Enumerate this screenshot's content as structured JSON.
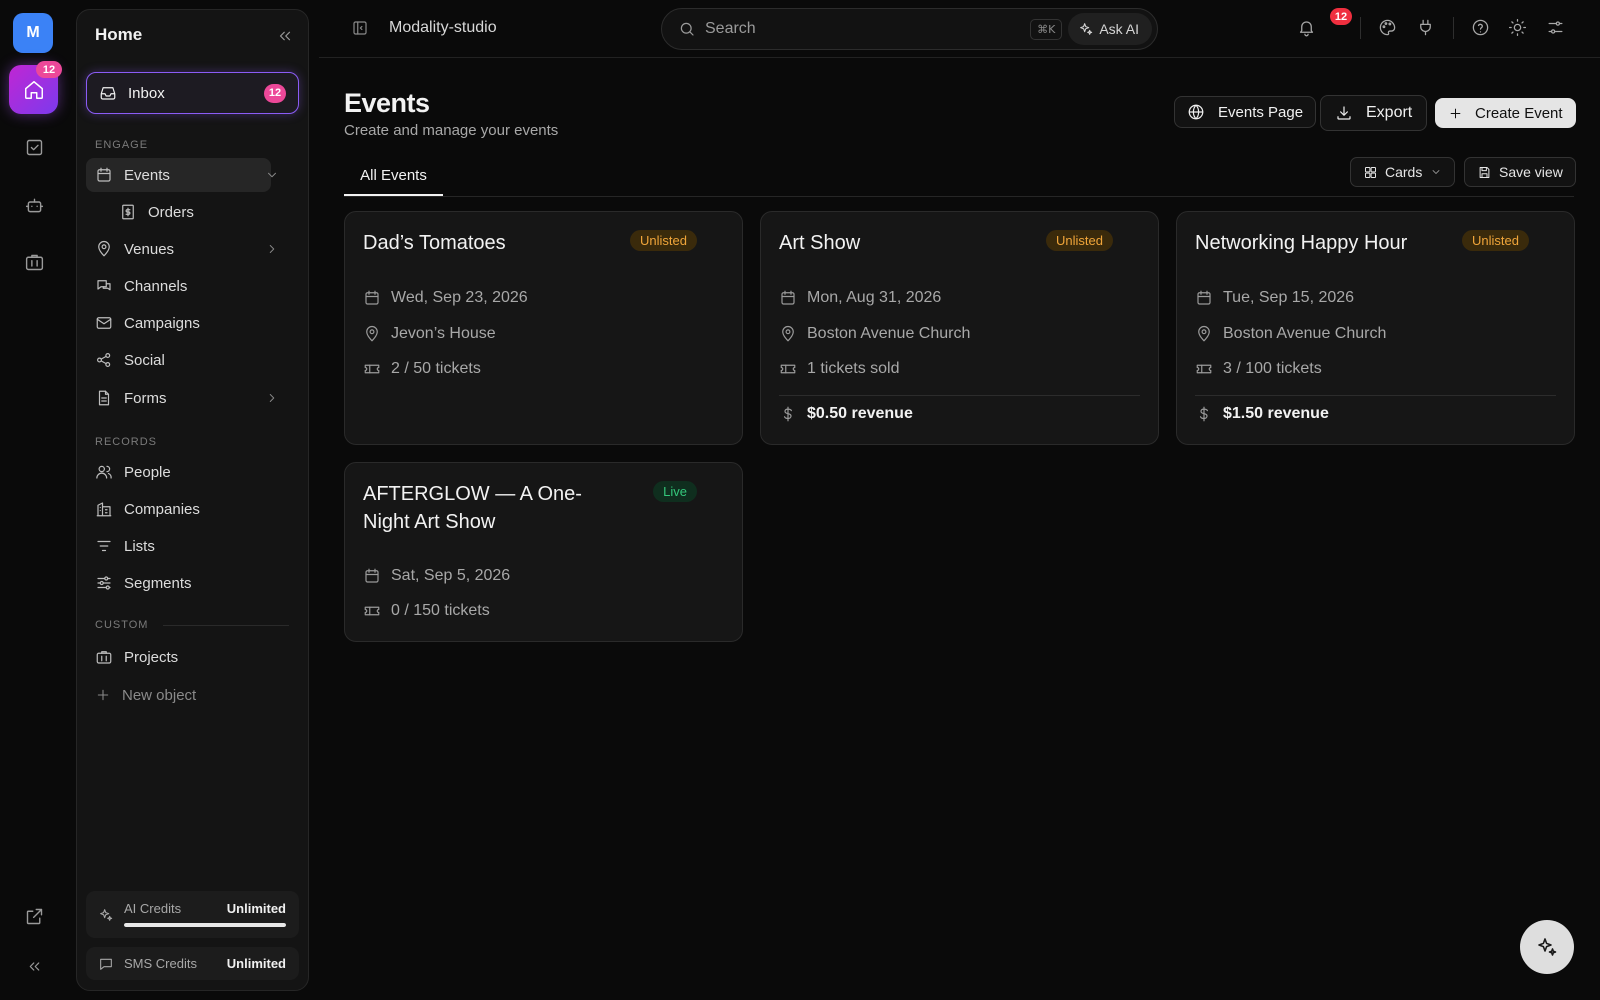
{
  "rail": {
    "avatar_letter": "M",
    "home_badge": "12"
  },
  "sidebar": {
    "title": "Home",
    "inbox": {
      "label": "Inbox",
      "badge": "12"
    },
    "engage_heading": "ENGAGE",
    "engage": [
      {
        "label": "Events",
        "icon": "calendar-icon"
      },
      {
        "label": "Orders",
        "icon": "receipt-icon"
      },
      {
        "label": "Venues",
        "icon": "map-pin-icon"
      },
      {
        "label": "Channels",
        "icon": "chat-icon"
      },
      {
        "label": "Campaigns",
        "icon": "mail-icon"
      },
      {
        "label": "Social",
        "icon": "share-icon"
      },
      {
        "label": "Forms",
        "icon": "document-icon"
      }
    ],
    "records_heading": "RECORDS",
    "records": [
      {
        "label": "People",
        "icon": "users-icon"
      },
      {
        "label": "Companies",
        "icon": "building-icon"
      },
      {
        "label": "Lists",
        "icon": "filter-icon"
      },
      {
        "label": "Segments",
        "icon": "sliders-icon"
      }
    ],
    "custom_heading": "CUSTOM",
    "custom": [
      {
        "label": "Projects",
        "icon": "briefcase-icon"
      },
      {
        "label": "New object",
        "icon": "plus-icon"
      }
    ],
    "ai_credits": {
      "label": "AI Credits",
      "value": "Unlimited",
      "fill": 1.0
    },
    "sms_credits": {
      "label": "SMS Credits",
      "value": "Unlimited"
    }
  },
  "topbar": {
    "workspace": "Modality-studio",
    "search_placeholder": "Search",
    "shortcut": "⌘K",
    "ask_ai": "Ask AI",
    "notification_badge": "12"
  },
  "page": {
    "title": "Events",
    "subtitle": "Create and manage your events",
    "events_page_label": "Events Page",
    "export_label": "Export",
    "create_label": "Create Event",
    "tab": "All Events",
    "view_label": "Cards",
    "save_view_label": "Save view"
  },
  "events": [
    {
      "title": "Dad’s Tomatoes",
      "status": "Unlisted",
      "date": "Wed, Sep 23, 2026",
      "location": "Jevon’s House",
      "tickets": "2 / 50 tickets",
      "revenue": ""
    },
    {
      "title": "Art Show",
      "status": "Unlisted",
      "date": "Mon, Aug 31, 2026",
      "location": "Boston Avenue Church",
      "tickets": "1 tickets sold",
      "revenue": "$0.50 revenue"
    },
    {
      "title": "Networking Happy Hour",
      "status": "Unlisted",
      "date": "Tue, Sep 15, 2026",
      "location": "Boston Avenue Church",
      "tickets": "3 / 100 tickets",
      "revenue": "$1.50 revenue"
    },
    {
      "title": "AFTERGLOW — A One-Night Art Show",
      "status": "Live",
      "date": "Sat, Sep 5, 2026",
      "location": "",
      "tickets": "0 / 150 tickets",
      "revenue": ""
    }
  ],
  "colors": {
    "accent": "#8b5cf6",
    "badge": "#ec4899",
    "unlisted": "#f0a53a",
    "live": "#34c77b"
  }
}
